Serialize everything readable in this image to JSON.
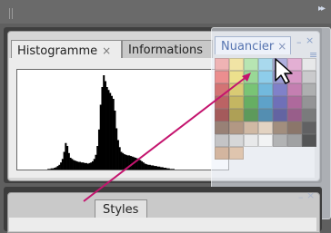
{
  "tabs": {
    "histogram": "Histogramme",
    "info": "Informations",
    "close_glyph": "×"
  },
  "floating_panel": {
    "title": "Nuancier",
    "close_glyph": "×"
  },
  "bottom_panel": {
    "tab": "Styles"
  },
  "colors": {
    "accent_arrow": "#c4146e",
    "swatches": [
      "#f1a0a0",
      "#f3e18c",
      "#a6e39d",
      "#93d3ec",
      "#9b9bd6",
      "#e19ac9",
      "#e6e6e6",
      "#e86b6b",
      "#eddc6b",
      "#7ed177",
      "#6fc3e8",
      "#8080cc",
      "#d27ab7",
      "#bfbfbf",
      "#c94747",
      "#d4c04a",
      "#54b64c",
      "#4aa8d6",
      "#5d5dbc",
      "#b75a9c",
      "#9a9a9a",
      "#a83232",
      "#b8a432",
      "#3a9933",
      "#2f89bb",
      "#4646a5",
      "#9a3d80",
      "#777777",
      "#8a2626",
      "#9a8722",
      "#2e7f29",
      "#226f9c",
      "#363688",
      "#7d2f67",
      "#555555",
      "#7a5a4a",
      "#a07c60",
      "#c7a88a",
      "#e1cbb2",
      "#8a6f58",
      "#6b4e3d",
      "#333333",
      "#b4b4b4",
      "#d0d0d0",
      "#e8e8e8",
      "#f5f5f5",
      "#a0a0a0",
      "#888888",
      "#222222",
      "#c8a080",
      "#dcb898"
    ]
  },
  "histogram": {
    "bins": [
      0,
      0,
      0,
      0,
      0,
      0,
      0,
      0,
      0,
      0,
      0,
      0,
      0,
      0,
      0,
      0,
      0,
      0,
      0,
      1,
      1,
      2,
      2,
      3,
      4,
      6,
      8,
      12,
      18,
      30,
      45,
      40,
      28,
      20,
      18,
      16,
      15,
      14,
      13,
      13,
      12,
      12,
      11,
      11,
      10,
      11,
      12,
      14,
      18,
      25,
      40,
      68,
      110,
      140,
      160,
      150,
      140,
      135,
      130,
      125,
      120,
      100,
      70,
      50,
      38,
      30,
      28,
      26,
      25,
      24,
      24,
      23,
      22,
      21,
      20,
      19,
      18,
      16,
      14,
      12,
      10,
      9,
      8,
      8,
      7,
      7,
      6,
      6,
      5,
      5,
      4,
      4,
      3,
      3,
      2,
      2,
      1,
      1,
      1,
      0,
      0,
      0,
      0,
      0,
      0,
      0,
      0,
      0,
      0,
      0,
      0,
      0,
      0,
      0,
      0,
      0,
      0,
      0,
      0,
      0,
      0,
      0,
      0,
      0,
      0,
      0,
      0,
      0,
      0,
      0,
      0,
      0,
      0
    ]
  }
}
